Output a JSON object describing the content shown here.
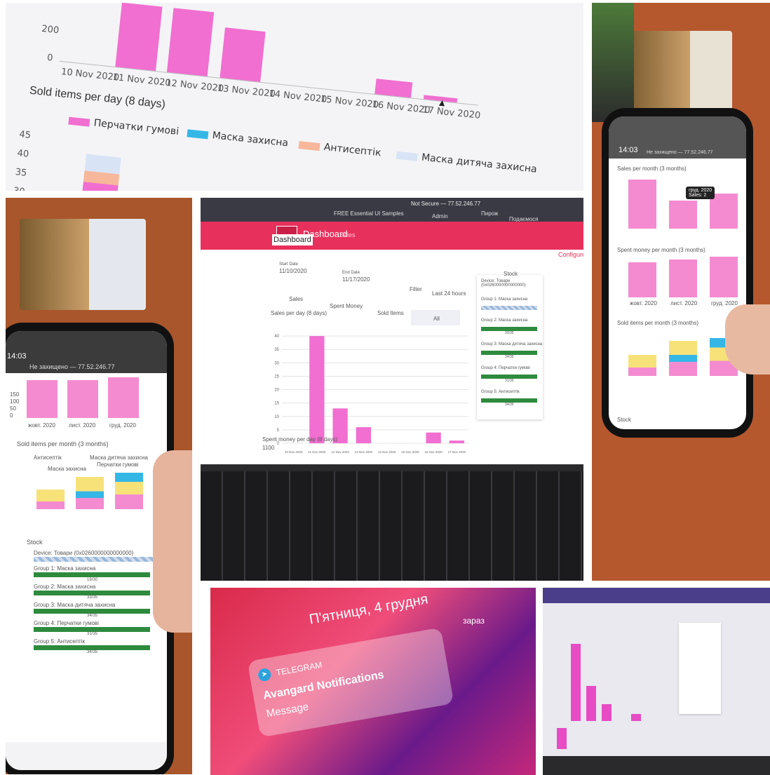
{
  "closeup": {
    "y_top_tick": "200",
    "y_zero_tick": "0",
    "dates": [
      "10 Nov 2020",
      "11 Nov 2020",
      "12 Nov 2020",
      "13 Nov 2020",
      "14 Nov 2020",
      "15 Nov 2020",
      "16 Nov 2020",
      "17 Nov 2020"
    ],
    "title": "Sold items per day (8 days)",
    "y_ticks": [
      "45",
      "40",
      "35",
      "30"
    ],
    "legend": [
      "Перчатки гумові",
      "Маска захисна",
      "Антисептік",
      "Маска дитяча захисна"
    ],
    "legend_colors": [
      "#f06fd0",
      "#35b7e6",
      "#f6b79a",
      "#d8e4f5"
    ]
  },
  "phone_right": {
    "time": "14:03",
    "address": "Не захищено — 77.52.246.77",
    "chart1_title": "Sales per month (3 months)",
    "tooltip_month": "груд. 2020",
    "tooltip_value": "Sales: 2",
    "chart2_title": "Spent money per month (3 months)",
    "chart3_title": "Sold items per month (3 months)",
    "months": [
      "жовт. 2020",
      "лист. 2020",
      "груд. 2020"
    ],
    "stock_label": "Stock"
  },
  "phone_left": {
    "time": "14:03",
    "address": "Не захищено — 77.52.246.77",
    "y_ticks": [
      "150",
      "100",
      "50",
      "0"
    ],
    "months": [
      "жовт. 2020",
      "лист. 2020",
      "груд. 2020"
    ],
    "chart_title": "Sold items per month (3 months)",
    "legend": [
      "Антисептік",
      "Маска дитяча захисна",
      "Перчатки гумові",
      "Маска захисна"
    ],
    "stock_title": "Stock",
    "device": "Device: Товари (0x0260000000000000)",
    "groups": [
      {
        "name": "Group 1: Маска захисна",
        "value": "19/30"
      },
      {
        "name": "Group 2: Маска захисна",
        "value": "33/35"
      },
      {
        "name": "Group 3: Маска дитяча захисна",
        "value": "34/35"
      },
      {
        "name": "Group 4: Перчатки гумові",
        "value": "31/35"
      },
      {
        "name": "Group 5: Антисептік",
        "value": "34/35"
      }
    ]
  },
  "laptop": {
    "tab_url": "Not Secure — 77.52.246.77",
    "bookmarks": [
      "FREE Essential UI Samples",
      "Admin",
      "Пирож",
      "Подаємося"
    ],
    "nav_dashboard": "Dashboard",
    "nav_sales": "Sales",
    "configure": "Configure",
    "page_title": "Dashboard",
    "start_label": "Start Date",
    "start_value": "11/10/2020",
    "end_label": "End Date",
    "end_value": "11/17/2020",
    "filter_button": "Filter",
    "last24_button": "Last 24 hours",
    "tabs": [
      "Sales",
      "Spent Money",
      "Sold Items",
      "All"
    ],
    "chart_title": "Sales per day (8 days)",
    "chart2_title": "Spent money per day (8 days)",
    "chart2_top_tick": "1100",
    "y_ticks": [
      "40",
      "35",
      "30",
      "25",
      "20",
      "15",
      "10",
      "5",
      "0"
    ],
    "dates": [
      "10 Nov 2020",
      "11 Nov 2020",
      "12 Nov 2020",
      "13 Nov 2020",
      "14 Nov 2020",
      "15 Nov 2020",
      "16 Nov 2020",
      "17 Nov 2020"
    ],
    "stock_title": "Stock",
    "device": "Device: Товари (0x0260000000000000)",
    "groups": [
      {
        "name": "Group 1: Маска захисна",
        "value": ""
      },
      {
        "name": "Group 2: Маска захисна",
        "value": "33/35"
      },
      {
        "name": "Group 3: Маска дитяча захисна",
        "value": "34/35"
      },
      {
        "name": "Group 4: Перчатки гумові",
        "value": "31/35"
      },
      {
        "name": "Group 5: Антисептік",
        "value": "34/35"
      }
    ]
  },
  "tablet": {
    "date": "П'ятниця, 4 грудня",
    "now": "зараз",
    "app": "TELEGRAM",
    "title": "Avangard Notifications",
    "body": "Message"
  },
  "chart_data": [
    {
      "type": "bar",
      "categories": [
        "10 Nov 2020",
        "11 Nov 2020",
        "12 Nov 2020",
        "13 Nov 2020",
        "14 Nov 2020",
        "15 Nov 2020",
        "16 Nov 2020",
        "17 Nov 2020"
      ],
      "values": [
        0,
        40,
        13,
        6,
        0,
        0,
        4,
        1
      ],
      "title": "Sales per day (8 days)",
      "ylim": [
        0,
        45
      ],
      "color": "#f06fd0"
    }
  ]
}
